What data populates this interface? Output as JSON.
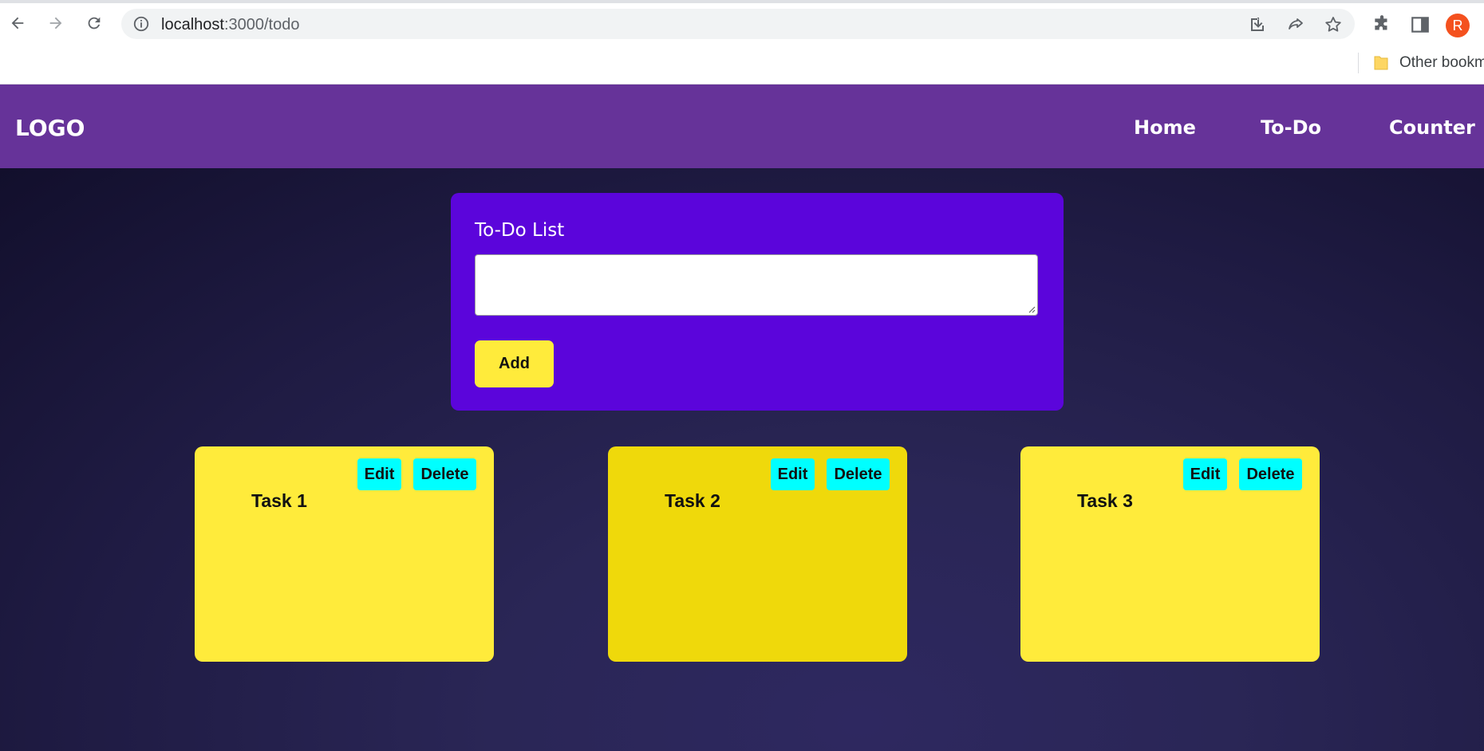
{
  "browser": {
    "url_host": "localhost",
    "url_path": ":3000/todo",
    "profile_initial": "R",
    "bookmarks_label": "Other bookm"
  },
  "nav": {
    "logo": "LOGO",
    "links": [
      {
        "label": "Home"
      },
      {
        "label": "To-Do"
      },
      {
        "label": "Counter"
      }
    ]
  },
  "todo": {
    "title": "To-Do List",
    "input_value": "",
    "add_label": "Add"
  },
  "tasks": [
    {
      "title": "Task 1",
      "edit_label": "Edit",
      "delete_label": "Delete"
    },
    {
      "title": "Task 2",
      "edit_label": "Edit",
      "delete_label": "Delete"
    },
    {
      "title": "Task 3",
      "edit_label": "Edit",
      "delete_label": "Delete"
    }
  ],
  "colors": {
    "navbar": "#663399",
    "form_card": "#5b05db",
    "task_card": "#ffeb3b",
    "task_card_hover": "#efd90b",
    "action_button": "#00ffff",
    "add_button": "#ffeb3b"
  }
}
